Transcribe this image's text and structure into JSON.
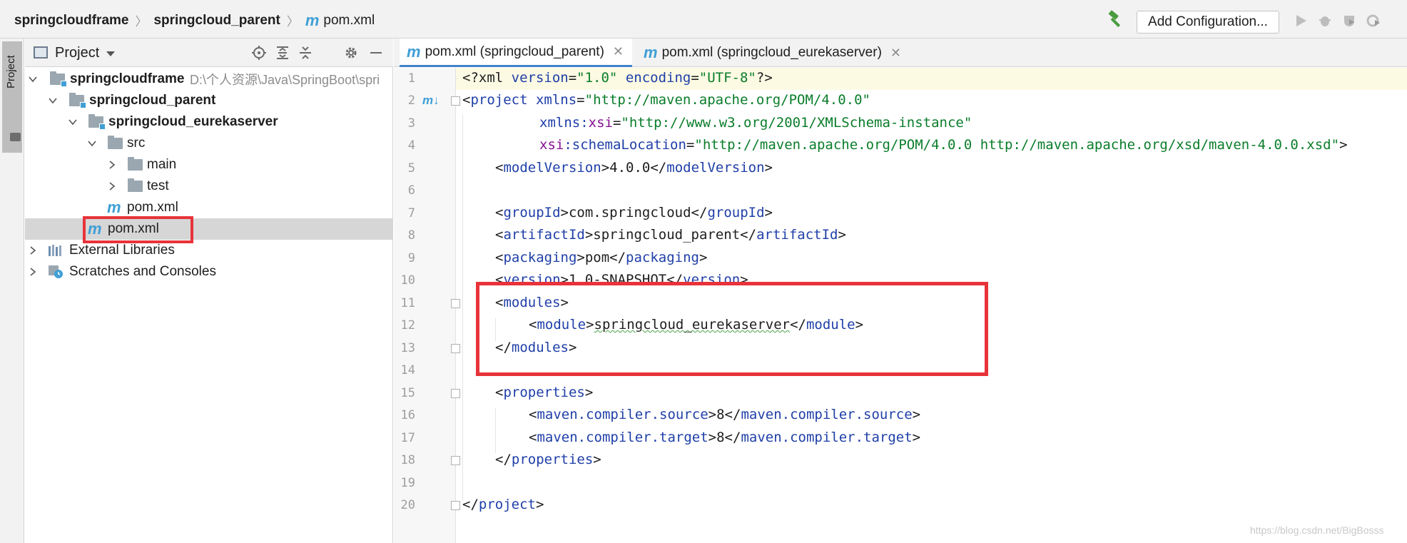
{
  "breadcrumb": {
    "root": "springcloudframe",
    "parent": "springcloud_parent",
    "file": "pom.xml"
  },
  "toolbar": {
    "run_config_label": "Add Configuration...",
    "icons": [
      "hammer-icon",
      "run-icon",
      "debug-icon",
      "coverage-icon",
      "profile-icon"
    ]
  },
  "side_strip": {
    "label": "Project"
  },
  "project_panel": {
    "title": "Project",
    "header_icons": [
      "locate-icon",
      "expand-all-icon",
      "collapse-all-icon",
      "gear-icon",
      "minimize-icon"
    ],
    "tree": [
      {
        "label": "springcloudframe",
        "path": "D:\\个人资源\\Java\\SpringBoot\\spri",
        "bold": true
      },
      {
        "label": "springcloud_parent",
        "bold": true
      },
      {
        "label": "springcloud_eurekaserver",
        "bold": true
      },
      {
        "label": "src"
      },
      {
        "label": "main"
      },
      {
        "label": "test"
      },
      {
        "label": "pom.xml"
      },
      {
        "label": "pom.xml",
        "selected": true
      },
      {
        "label": "External Libraries"
      },
      {
        "label": "Scratches and Consoles"
      }
    ]
  },
  "editor": {
    "tabs": [
      {
        "label": "pom.xml (springcloud_parent)",
        "active": true
      },
      {
        "label": "pom.xml (springcloud_eurekaserver)",
        "active": false
      }
    ],
    "line_numbers": [
      "1",
      "2",
      "3",
      "4",
      "5",
      "6",
      "7",
      "8",
      "9",
      "10",
      "11",
      "12",
      "13",
      "14",
      "15",
      "16",
      "17",
      "18",
      "19",
      "20"
    ],
    "code": {
      "l1": {
        "a": "<?xml ",
        "b": "version",
        "c": "=",
        "d": "\"1.0\"",
        "e": " ",
        "f": "encoding",
        "g": "=",
        "h": "\"UTF-8\"",
        "i": "?>"
      },
      "l2": {
        "a": "<",
        "b": "project ",
        "c": "xmlns",
        "d": "=",
        "e": "\"http://maven.apache.org/POM/4.0.0\""
      },
      "l3": {
        "a": "xmlns:",
        "b": "xsi",
        "c": "=",
        "d": "\"http://www.w3.org/2001/XMLSchema-instance\""
      },
      "l4": {
        "a": "xsi",
        "b": ":schemaLocation",
        "c": "=",
        "d": "\"http://maven.apache.org/POM/4.0.0 http://maven.apache.org/xsd/maven-4.0.0.xsd\"",
        "e": ">"
      },
      "l5": {
        "a": "<",
        "b": "modelVersion",
        "c": ">4.0.0</",
        "d": "modelVersion",
        "e": ">"
      },
      "l7": {
        "a": "<",
        "b": "groupId",
        "c": ">com.springcloud</",
        "d": "groupId",
        "e": ">"
      },
      "l8": {
        "a": "<",
        "b": "artifactId",
        "c": ">springcloud_parent</",
        "d": "artifactId",
        "e": ">"
      },
      "l9": {
        "a": "<",
        "b": "packaging",
        "c": ">pom</",
        "d": "packaging",
        "e": ">"
      },
      "l10": {
        "a": "<",
        "b": "version",
        "c": ">1.0-SNAPSHOT</",
        "d": "version",
        "e": ">"
      },
      "l11": {
        "a": "<",
        "b": "modules",
        "c": ">"
      },
      "l12": {
        "a": "<",
        "b": "module",
        "c": ">",
        "d": "springcloud_eurekaserver",
        "e": "</",
        "f": "module",
        "g": ">"
      },
      "l13": {
        "a": "</",
        "b": "modules",
        "c": ">"
      },
      "l15": {
        "a": "<",
        "b": "properties",
        "c": ">"
      },
      "l16": {
        "a": "<",
        "b": "maven.compiler.source",
        "c": ">8</",
        "d": "maven.compiler.source",
        "e": ">"
      },
      "l17": {
        "a": "<",
        "b": "maven.compiler.target",
        "c": ">8</",
        "d": "maven.compiler.target",
        "e": ">"
      },
      "l18": {
        "a": "</",
        "b": "properties",
        "c": ">"
      },
      "l20": {
        "a": "</",
        "b": "project",
        "c": ">"
      }
    }
  },
  "watermark": "https://blog.csdn.net/BigBosss",
  "colors": {
    "accent": "#3f9fd6",
    "highlight_box": "#e8333a",
    "xml_tag": "#1f3fa8",
    "xml_value": "#0a7d2a",
    "xml_namespace": "#871094"
  }
}
